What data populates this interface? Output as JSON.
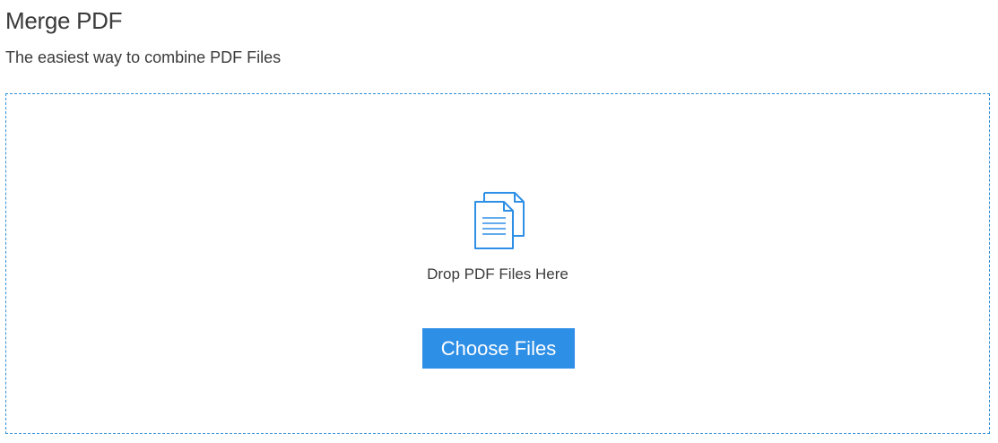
{
  "header": {
    "title": "Merge PDF",
    "subtitle": "The easiest way to combine PDF Files"
  },
  "drop_zone": {
    "icon": "documents-icon",
    "label": "Drop PDF Files Here",
    "button_label": "Choose Files"
  },
  "colors": {
    "accent": "#2e8fe6",
    "border": "#2e8fd8",
    "text": "#3a3a3a",
    "background": "#ffffff"
  }
}
